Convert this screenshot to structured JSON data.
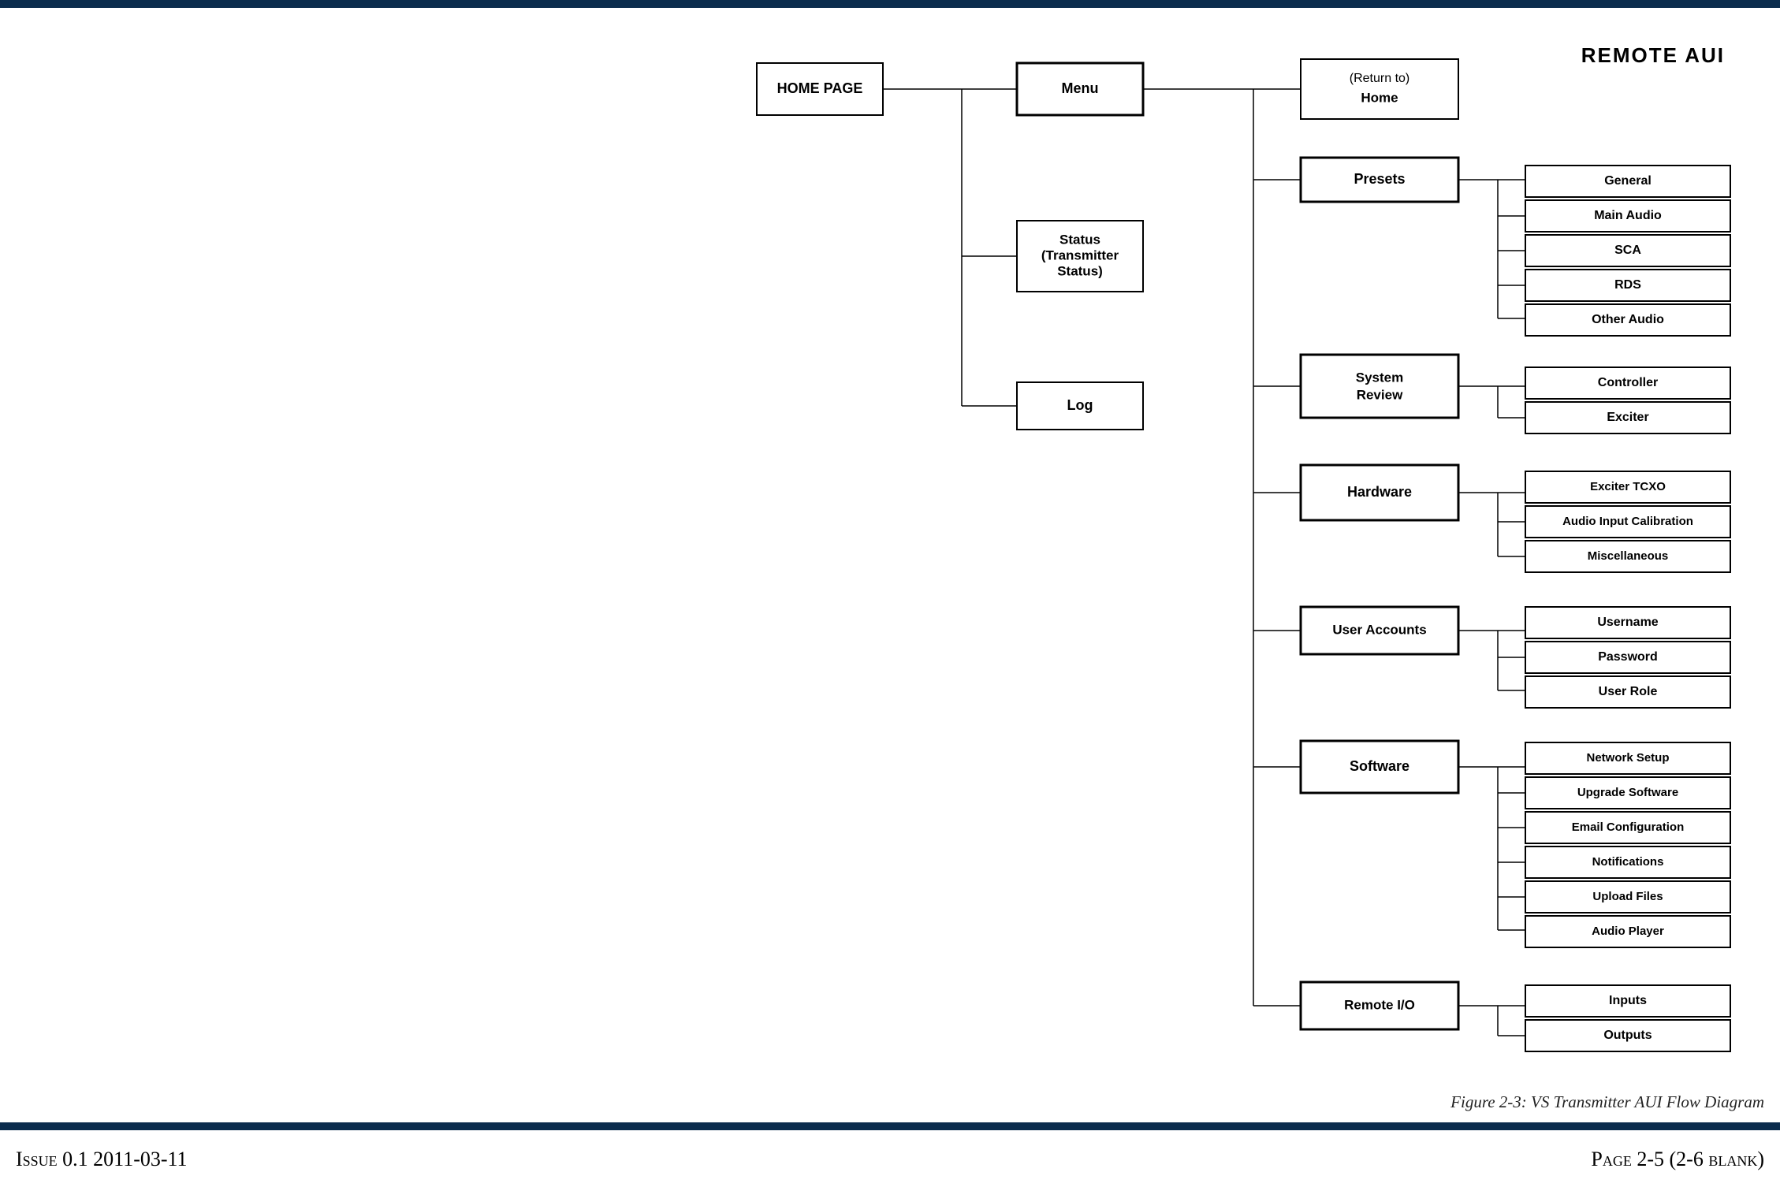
{
  "title": "REMOTE AUI",
  "caption": "Figure 2-3: VS Transmitter AUI Flow Diagram",
  "footer_left": "Issue 0.1 2011-03-11",
  "footer_right": "Page 2-5 (2-6 blank)",
  "root": {
    "home_page": "HOME PAGE",
    "menu": "Menu",
    "menu_children": {
      "status_line1": "Status",
      "status_line2": "(Transmitter",
      "status_line3": "Status)",
      "log": "Log",
      "return_to_line1": "(Return to)",
      "return_to_line2": "Home",
      "presets": {
        "label": "Presets",
        "items": [
          "General",
          "Main Audio",
          "SCA",
          "RDS",
          "Other Audio"
        ]
      },
      "system_review": {
        "label_line1": "System",
        "label_line2": "Review",
        "items": [
          "Controller",
          "Exciter"
        ]
      },
      "hardware": {
        "label": "Hardware",
        "items": [
          "Exciter TCXO",
          "Audio Input Calibration",
          "Miscellaneous"
        ]
      },
      "user_accounts": {
        "label": "User Accounts",
        "items": [
          "Username",
          "Password",
          "User Role"
        ]
      },
      "software": {
        "label": "Software",
        "items": [
          "Network Setup",
          "Upgrade Software",
          "Email Configuration",
          "Notifications",
          "Upload Files",
          "Audio Player"
        ]
      },
      "remote_io": {
        "label": "Remote I/O",
        "items": [
          "Inputs",
          "Outputs"
        ]
      }
    }
  }
}
